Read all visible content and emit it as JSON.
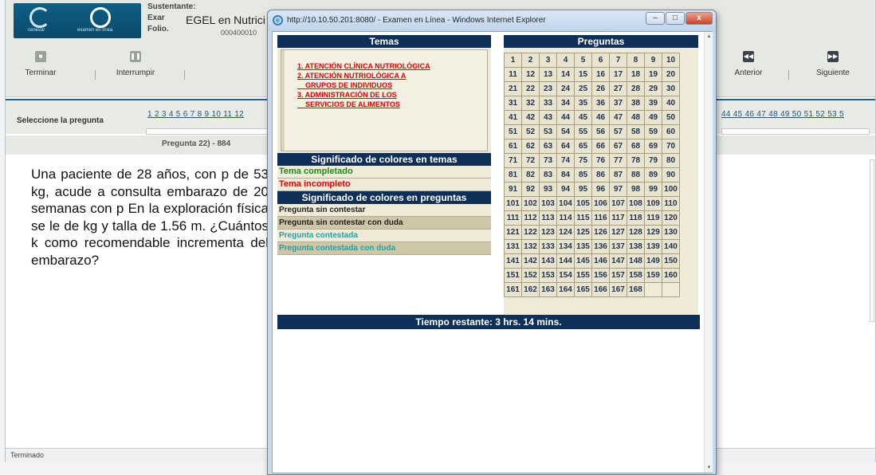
{
  "app": {
    "logo_left_caption": "ceneval",
    "logo_right_caption": "examen en línea",
    "header_labels": [
      "Sustentante:",
      "Exar",
      "Folio."
    ],
    "exam_name": "EGEL en Nutrici",
    "folio_value": "000400010",
    "toolbar": {
      "terminar": "Terminar",
      "interrumpir": "Interrumpir",
      "anterior": "Anterior",
      "siguiente": "Siguiente",
      "colors": {
        "terminar": "#9aa39a",
        "interrumpir": "#9aa39a",
        "anterior": "#3a4248",
        "siguiente": "#3a4248"
      }
    },
    "selector_label": "Seleccione la pregunta",
    "selector_links_left": "1 2 3 4 5 6 7 8 9 10 11 12",
    "selector_links_right": "44 45 46 47 48 49 50 51 52 53 5",
    "question_title": "Pregunta 22) - 884",
    "question_text": "Una paciente de 28 años, con p de 53 kg, acude a consulta embarazo de 20 semanas con p En la exploración física se le de kg y talla de 1.56 m. ¿Cuántos k como recomendable incrementa del embarazo?",
    "status": "Terminado"
  },
  "popup": {
    "window_title": "http://10.10.50.201:8080/ - Examen en Línea - Windows Internet Explorer",
    "window_buttons": {
      "minimize": "–",
      "maximize": "□",
      "close": "x"
    },
    "temas_header": "Temas",
    "topics": [
      "1. ATENCIÓN CLÍNICA  NUTRIOLÓGICA",
      "2. ATENCIÓN NUTRIOLÓGICA A",
      "    GRUPOS DE INDIVIDUOS",
      "3. ADMINISTRACIÓN DE LOS",
      "    SERVICIOS DE ALIMENTOS"
    ],
    "topic_colors_header": "Significado de colores en temas",
    "topic_legend": [
      {
        "label": "Tema completado",
        "color": "#1a8a1a"
      },
      {
        "label": "Tema incompleto",
        "color": "#e00000"
      }
    ],
    "question_colors_header": "Significado de colores en preguntas",
    "question_legend": [
      {
        "label": "Pregunta sin contestar",
        "color": "#222222",
        "bg": "#efebd8"
      },
      {
        "label": "Pregunta sin contestar con duda",
        "color": "#222222",
        "bg": "#cfc6a8"
      },
      {
        "label": "Pregunta contestada",
        "color": "#1fa3a8",
        "bg": "#efebd8"
      },
      {
        "label": "Pregunta contestada con duda",
        "color": "#1fa3a8",
        "bg": "#cfc6a8"
      }
    ],
    "preguntas_header": "Preguntas",
    "total_questions": 168,
    "time_remaining": "Tiempo restante: 3 hrs. 14 mins."
  }
}
